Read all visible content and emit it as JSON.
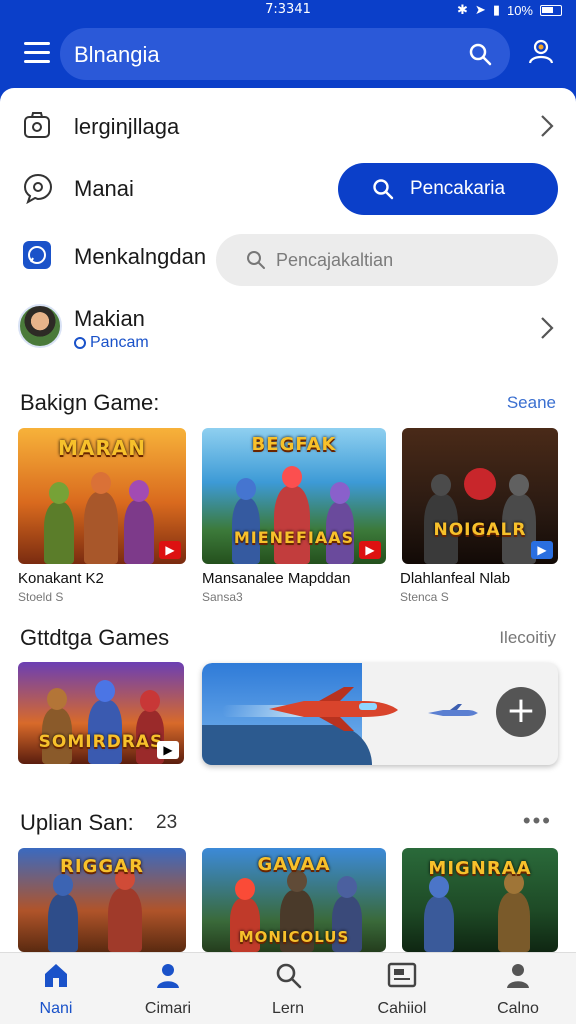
{
  "status_bar": {
    "time": "7:3341",
    "battery": "10%"
  },
  "app_bar": {
    "title": "Blnangia"
  },
  "menu": [
    {
      "label": "lerginjllaga"
    },
    {
      "label": "Manai"
    },
    {
      "label": "Menkalngdan"
    },
    {
      "label": "Makian",
      "sub": "Pancam"
    }
  ],
  "primary_action": {
    "label": "Pencakaria"
  },
  "search": {
    "placeholder": "Pencajakaltian"
  },
  "sections": [
    {
      "title": "Bakign Game:",
      "link": "Seane",
      "cards": [
        {
          "art_title": "MARAN",
          "name": "Konakant K2",
          "sub": "Stoeld S",
          "badge": "red"
        },
        {
          "art_title": "BEGFAK",
          "art_title2": "MIENEFIAAS",
          "name": "Mansanalee Mapddan",
          "sub": "Sansa3",
          "badge": "red"
        },
        {
          "art_title": "NOIGALR",
          "name": "Dlahlanfeal Nlab",
          "sub": "Stenca S",
          "badge": "blue"
        }
      ]
    },
    {
      "title": "Gttdtga Games",
      "link": "Ilecoitiy",
      "cards": [
        {
          "art_title": "SOMIRDRAS",
          "badge": "white"
        }
      ]
    },
    {
      "title": "Uplian San:",
      "count": "23",
      "cards": [
        {
          "art_title": "RIGGAR"
        },
        {
          "art_title": "GAVAA",
          "art_title2": "MONICOLUS"
        },
        {
          "art_title": "MIGNRAA"
        }
      ]
    }
  ],
  "bottom_nav": [
    {
      "label": "Nani",
      "icon": "home-icon",
      "active": true
    },
    {
      "label": "Cimari",
      "icon": "person-icon"
    },
    {
      "label": "Lern",
      "icon": "search-icon"
    },
    {
      "label": "Cahiiol",
      "icon": "card-icon"
    },
    {
      "label": "Calno",
      "icon": "account-icon"
    }
  ],
  "colors": {
    "primary": "#0b3fc9",
    "link": "#3a6fd0",
    "badge_red": "#dd1111"
  }
}
